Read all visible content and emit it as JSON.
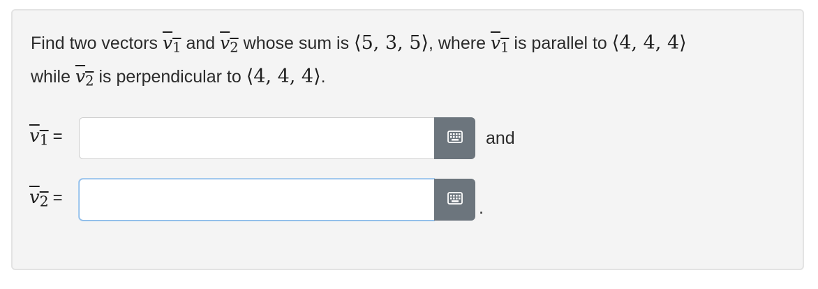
{
  "question": {
    "text_find": "Find two vectors",
    "v1_symbol": "v",
    "v1_sub": "1",
    "text_and": "and",
    "v2_symbol": "v",
    "v2_sub": "2",
    "text_sum": "whose sum is",
    "sum_vector": "⟨5, 3, 5⟩",
    "text_where": ", where",
    "text_parallel": "is parallel to",
    "parallel_vector": "⟨4, 4, 4⟩",
    "text_while": "while",
    "text_perp": "is perpendicular to",
    "perp_vector": "⟨4, 4, 4⟩",
    "text_end": "."
  },
  "answers": [
    {
      "symbol": "v",
      "sub": "1",
      "equals": "=",
      "value": "",
      "placeholder": "",
      "after": "and",
      "keyboard_icon": "keyboard-icon"
    },
    {
      "symbol": "v",
      "sub": "2",
      "equals": "=",
      "value": "",
      "placeholder": "",
      "after": ".",
      "keyboard_icon": "keyboard-icon"
    }
  ],
  "colors": {
    "card_bg": "#f4f4f4",
    "button_bg": "#6c757d",
    "focus_border": "#86b7e8"
  }
}
